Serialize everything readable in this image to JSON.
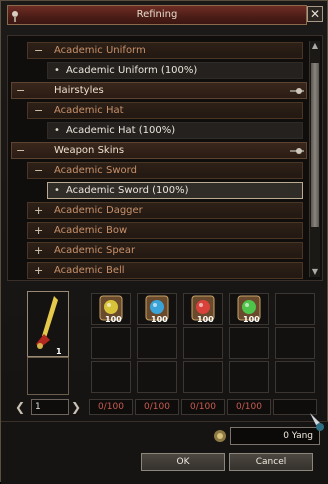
{
  "window": {
    "title": "Refining",
    "close_glyph": "✕"
  },
  "list": {
    "rows": [
      {
        "type": "sub",
        "sign": "−",
        "label": "Academic Uniform"
      },
      {
        "type": "item",
        "label": "Academic Uniform (100%)",
        "selected": false
      },
      {
        "type": "cat",
        "sign": "−",
        "label": "Hairstyles"
      },
      {
        "type": "sub",
        "sign": "−",
        "label": "Academic Hat"
      },
      {
        "type": "item",
        "label": "Academic Hat (100%)",
        "selected": false
      },
      {
        "type": "cat",
        "sign": "−",
        "label": "Weapon Skins"
      },
      {
        "type": "sub",
        "sign": "−",
        "label": "Academic Sword"
      },
      {
        "type": "item",
        "label": "Academic Sword (100%)",
        "selected": true
      },
      {
        "type": "sub",
        "sign": "+",
        "label": "Academic Dagger"
      },
      {
        "type": "sub",
        "sign": "+",
        "label": "Academic Bow"
      },
      {
        "type": "sub",
        "sign": "+",
        "label": "Academic Spear"
      },
      {
        "type": "sub",
        "sign": "+",
        "label": "Academic Bell"
      }
    ]
  },
  "result": {
    "icon": "sword-icon",
    "count": "1"
  },
  "materials": [
    {
      "icon": "yellow-gem-scroll-icon",
      "stack": "100",
      "color": "#d8c23a",
      "required": "0/100"
    },
    {
      "icon": "blue-gem-scroll-icon",
      "stack": "100",
      "color": "#3aa3d8",
      "required": "0/100"
    },
    {
      "icon": "red-gem-scroll-icon",
      "stack": "100",
      "color": "#d8423a",
      "required": "0/100"
    },
    {
      "icon": "green-gem-scroll-icon",
      "stack": "100",
      "color": "#4fc44a",
      "required": "0/100"
    }
  ],
  "quantity": {
    "value": "1",
    "prev": "❮",
    "next": "❯"
  },
  "cost": {
    "value": "0 Yang",
    "icon": "coin-icon"
  },
  "buttons": {
    "ok": "OK",
    "cancel": "Cancel"
  }
}
